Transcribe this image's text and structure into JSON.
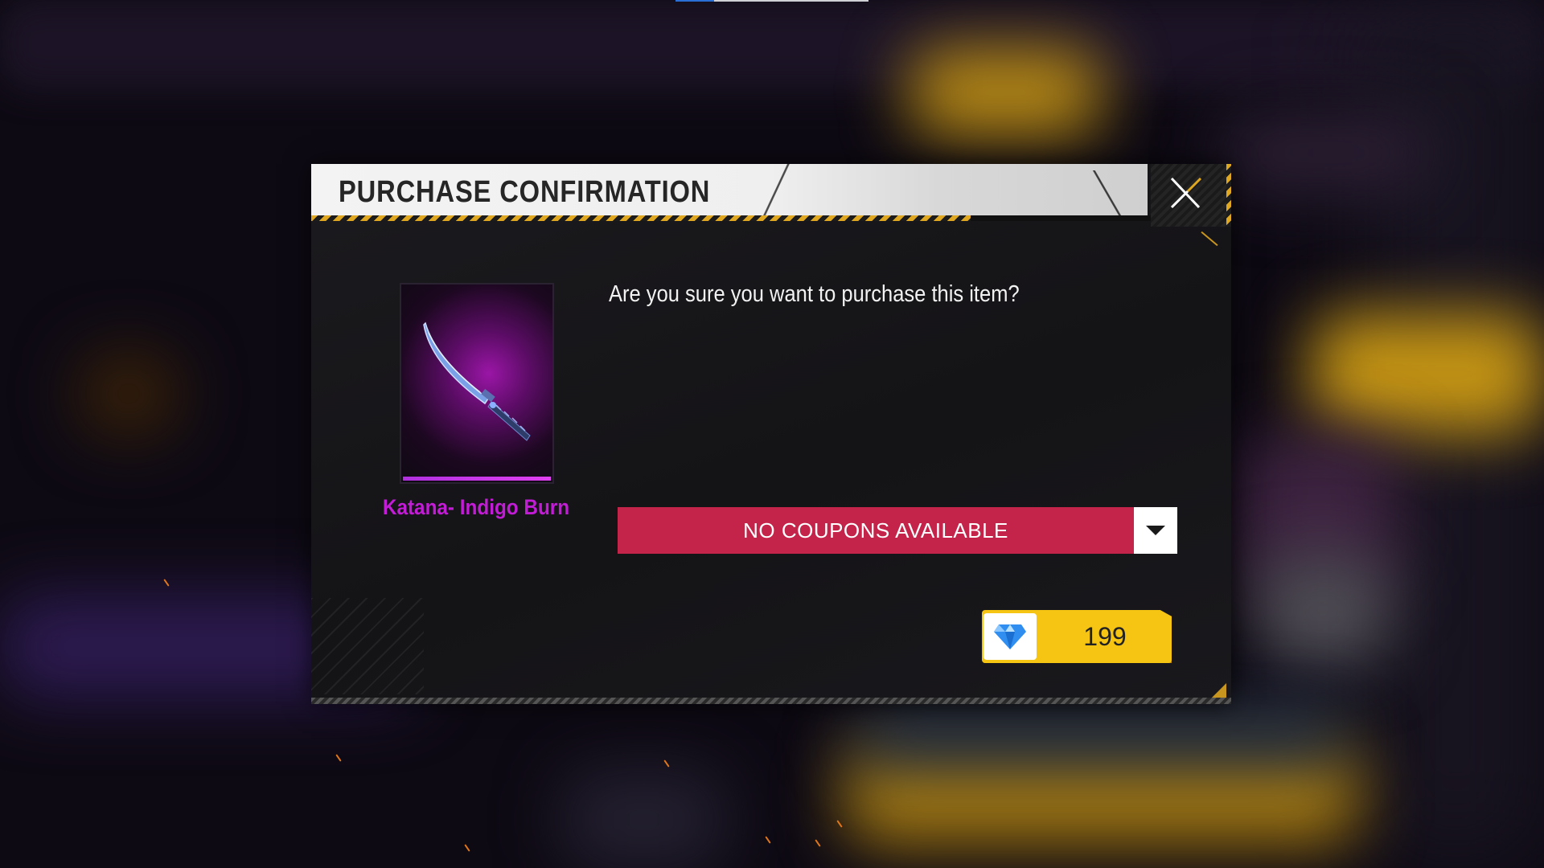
{
  "dialog": {
    "title": "PURCHASE CONFIRMATION",
    "question": "Are you sure you want to purchase this item?",
    "item": {
      "name": "Katana- Indigo Burn",
      "name_color": "#c21cd6"
    },
    "coupon": {
      "label": "NO COUPONS AVAILABLE",
      "color": "#c4244a"
    },
    "price": {
      "currency_icon": "diamond-icon",
      "value": "199",
      "color": "#f6c514"
    },
    "close_icon": "close-icon"
  }
}
